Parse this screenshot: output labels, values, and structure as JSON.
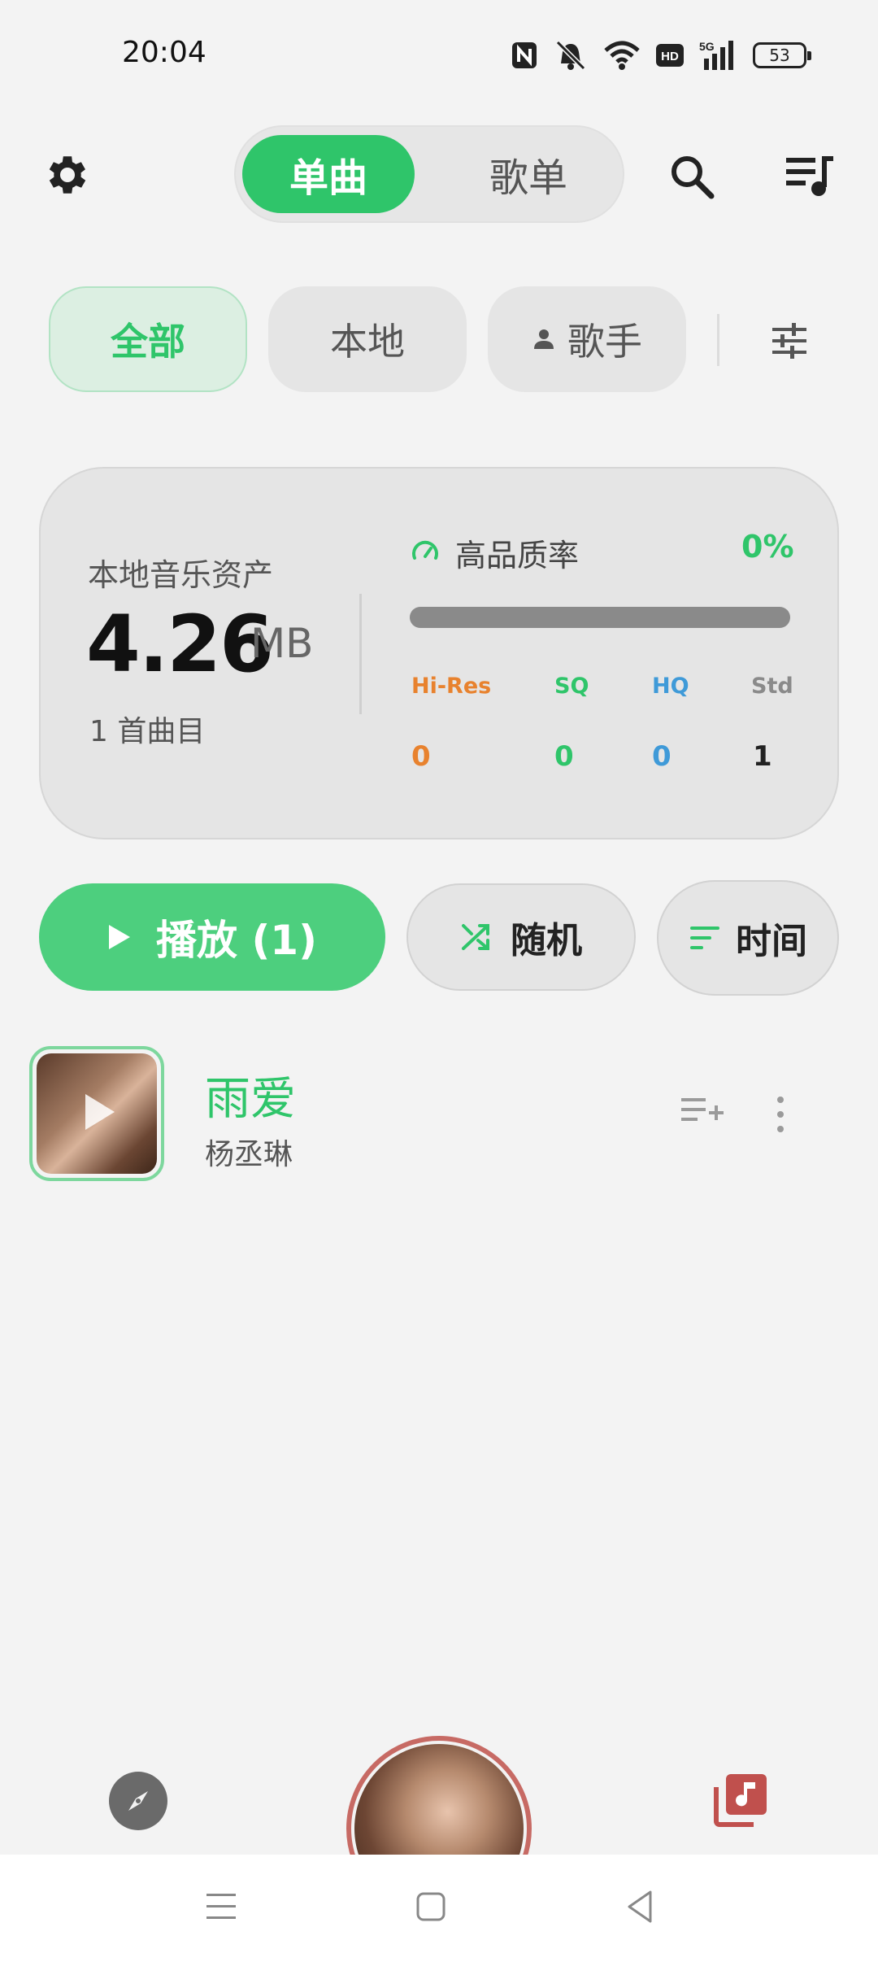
{
  "status_bar": {
    "time": "20:04",
    "icons": [
      "nfc-icon",
      "mute-icon",
      "wifi-icon",
      "hd-icon",
      "signal-5g-icon",
      "battery-icon"
    ],
    "hd_label": "HD",
    "network_label": "5G",
    "battery": "53"
  },
  "top_bar": {
    "tabs": [
      {
        "label": "单曲",
        "active": true
      },
      {
        "label": "歌单",
        "active": false
      }
    ]
  },
  "filters": {
    "chips": [
      {
        "label": "全部",
        "active": true
      },
      {
        "label": "本地",
        "active": false
      },
      {
        "label": "歌手",
        "active": false
      }
    ]
  },
  "stats": {
    "assets_label": "本地音乐资产",
    "size_value": "4.26",
    "size_unit": "MB",
    "track_count": "1 首曲目",
    "quality_label": "高品质率",
    "quality_percent": "0%",
    "quality_fraction": 0,
    "columns": [
      {
        "label": "Hi-Res",
        "value": "0",
        "color": "#e8822e"
      },
      {
        "label": "SQ",
        "value": "0",
        "color": "#2fc56a"
      },
      {
        "label": "HQ",
        "value": "0",
        "color": "#3f9ad8"
      },
      {
        "label": "Std",
        "value": "1",
        "color": "#8a8a8a"
      }
    ]
  },
  "actions": {
    "play_label": "播放 (1)",
    "shuffle_label": "随机",
    "sort_label": "时间"
  },
  "songs": [
    {
      "title": "雨爱",
      "artist": "杨丞琳"
    }
  ],
  "colors": {
    "accent": "#2fc56a",
    "library_icon": "#c0504d"
  }
}
